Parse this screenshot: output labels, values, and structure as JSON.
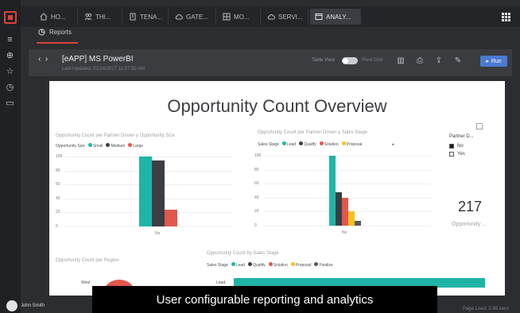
{
  "tabs": [
    "HO...",
    "THI...",
    "TENA...",
    "GATE...",
    "MO...",
    "SERVI...",
    "ANALY..."
  ],
  "subtab": "Reports",
  "report": {
    "title": "[eAPP] MS PowerBI",
    "last_updated": "Last Updated: 01/24/2017 11:57:50 AM",
    "table_view_label": "Table View",
    "table_view_state": "Pivot Grid",
    "run_label": "Run"
  },
  "canvas": {
    "title": "Opportunity Count Overview",
    "chart1_title": "Opportunity Count per Partner Driven y Opportunity Size",
    "chart1_legend_label": "Opportunity Size",
    "chart2_title": "Opportunity Count per Partner Driven y Sales Stage",
    "chart2_legend_label": "Sales Stage",
    "chart3_title": "Opportunity Count per Region",
    "chart3_cat": "West",
    "chart4_title": "Opportunity Count by Sales Stage",
    "chart4_legend_label": "Sales Stage",
    "chart4_row_label": "Lead",
    "slicer_title": "Partner D...",
    "slicer_options": [
      "No",
      "Yes"
    ],
    "kpi_value": "217",
    "kpi_label": "Opportunity ..."
  },
  "chart_data": [
    {
      "type": "bar",
      "categories": [
        "No"
      ],
      "yticks": [
        0,
        20,
        40,
        60,
        80,
        100
      ],
      "ylim": [
        0,
        100
      ],
      "series": [
        {
          "name": "Small",
          "values": [
            100
          ],
          "color": "#1fb5a6"
        },
        {
          "name": "Medium",
          "values": [
            94
          ],
          "color": "#3b3f44"
        },
        {
          "name": "Large",
          "values": [
            24
          ],
          "color": "#e2574c"
        }
      ]
    },
    {
      "type": "bar",
      "categories": [
        "No"
      ],
      "yticks": [
        0,
        20,
        40,
        60,
        80,
        100
      ],
      "ylim": [
        0,
        100
      ],
      "series": [
        {
          "name": "Lead",
          "values": [
            100
          ],
          "color": "#1fb5a6"
        },
        {
          "name": "Qualify",
          "values": [
            48
          ],
          "color": "#3b3f44"
        },
        {
          "name": "Solution",
          "values": [
            40
          ],
          "color": "#e2574c"
        },
        {
          "name": "Proposal",
          "values": [
            21
          ],
          "color": "#f5c11a"
        },
        {
          "name": "Finalize",
          "values": [
            7
          ],
          "color": "#555a60"
        }
      ]
    }
  ],
  "chart4_legend": [
    "Lead",
    "Qualify",
    "Solution",
    "Proposal",
    "Finalize"
  ],
  "user": {
    "name": "John Smith"
  },
  "caption": "User configurable reporting and analytics",
  "page_load": "Page Load: 0.48 secs"
}
